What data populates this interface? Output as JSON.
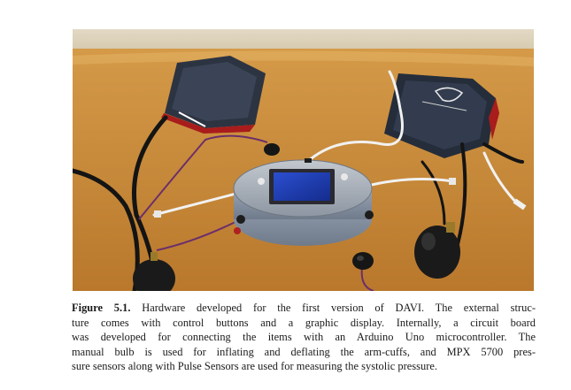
{
  "figure": {
    "label": "Figure 5.1.",
    "caption_lines": [
      " Hardware developed for the first version of DAVI. The external struc-",
      "ture comes with control buttons and a graphic display. Internally, a circuit board",
      "was developed for connecting the items with an Arduino Uno microcontroller. The",
      "manual bulb is used for inflating and deflating the arm-cuffs, and MPX 5700 pres-",
      "sure sensors along with Pulse Sensors are used for measuring the systolic pressure."
    ]
  },
  "colors": {
    "table_wood": "#c98c3d",
    "wall": "#d9cdb5",
    "device_body": "#8f9aa8",
    "screen": "#1f3fb0",
    "cuff": "#2c3442"
  }
}
